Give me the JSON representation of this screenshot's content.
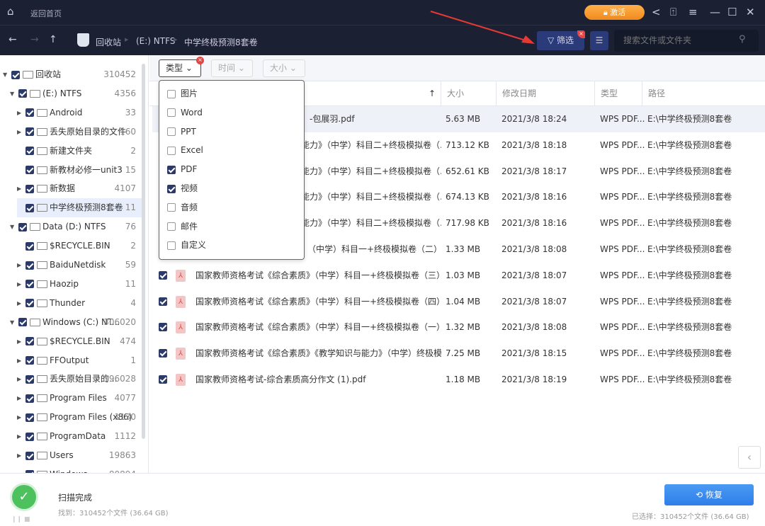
{
  "topbar": {
    "home_label": "返回首页",
    "activate_label": "激活"
  },
  "toolbar": {
    "breadcrumb": [
      "回收站",
      "(E:) NTFS",
      "中学终极预测8套卷"
    ],
    "filter_label": "筛选",
    "search_placeholder": "搜索文件或文件夹"
  },
  "tree": [
    {
      "label": "回收站",
      "count": "310452",
      "level": 0,
      "arrow": "▼",
      "checked": true,
      "icon": "recycle-bin"
    },
    {
      "label": "(E:) NTFS",
      "count": "4356",
      "level": 1,
      "arrow": "▼",
      "checked": true,
      "icon": "drive"
    },
    {
      "label": "Android",
      "count": "33",
      "level": 2,
      "arrow": "▶",
      "checked": true,
      "icon": "folder"
    },
    {
      "label": "丢失原始目录的文件",
      "count": "160",
      "level": 2,
      "arrow": "▶",
      "checked": true,
      "icon": "folder"
    },
    {
      "label": "新建文件夹",
      "count": "2",
      "level": 2,
      "arrow": "",
      "checked": true,
      "icon": "folder"
    },
    {
      "label": "新教材必修一unit3",
      "count": "15",
      "level": 2,
      "arrow": "",
      "checked": true,
      "icon": "folder"
    },
    {
      "label": "新数据",
      "count": "4107",
      "level": 2,
      "arrow": "▶",
      "checked": true,
      "icon": "folder"
    },
    {
      "label": "中学终极预测8套卷",
      "count": "11",
      "level": 2,
      "arrow": "",
      "checked": true,
      "icon": "folder",
      "selected": true
    },
    {
      "label": "Data (D:) NTFS",
      "count": "76",
      "level": 1,
      "arrow": "▼",
      "checked": true,
      "icon": "drive"
    },
    {
      "label": "$RECYCLE.BIN",
      "count": "2",
      "level": 2,
      "arrow": "",
      "checked": true,
      "icon": "recycle-bin"
    },
    {
      "label": "BaiduNetdisk",
      "count": "59",
      "level": 2,
      "arrow": "▶",
      "checked": true,
      "icon": "folder"
    },
    {
      "label": "Haozip",
      "count": "11",
      "level": 2,
      "arrow": "▶",
      "checked": true,
      "icon": "folder"
    },
    {
      "label": "Thunder",
      "count": "4",
      "level": 2,
      "arrow": "▶",
      "checked": true,
      "icon": "folder"
    },
    {
      "label": "Windows (C:) NT...",
      "count": "306020",
      "level": 1,
      "arrow": "▼",
      "checked": true,
      "icon": "drive"
    },
    {
      "label": "$RECYCLE.BIN",
      "count": "474",
      "level": 2,
      "arrow": "▶",
      "checked": true,
      "icon": "recycle-bin"
    },
    {
      "label": "FFOutput",
      "count": "1",
      "level": 2,
      "arrow": "▶",
      "checked": true,
      "icon": "folder"
    },
    {
      "label": "丢失原始目录的...",
      "count": "196028",
      "level": 2,
      "arrow": "▶",
      "checked": true,
      "icon": "folder"
    },
    {
      "label": "Program Files",
      "count": "4077",
      "level": 2,
      "arrow": "▶",
      "checked": true,
      "icon": "folder"
    },
    {
      "label": "Program Files (x86)",
      "count": "1130",
      "level": 2,
      "arrow": "▶",
      "checked": true,
      "icon": "folder"
    },
    {
      "label": "ProgramData",
      "count": "1112",
      "level": 2,
      "arrow": "▶",
      "checked": true,
      "icon": "folder"
    },
    {
      "label": "Users",
      "count": "19863",
      "level": 2,
      "arrow": "▶",
      "checked": true,
      "icon": "folder"
    },
    {
      "label": "Windows",
      "count": "80894",
      "level": 2,
      "arrow": "▶",
      "checked": true,
      "icon": "folder"
    }
  ],
  "filters": [
    {
      "label": "类型",
      "active": true
    },
    {
      "label": "时间",
      "active": false
    },
    {
      "label": "大小",
      "active": false
    }
  ],
  "type_menu": [
    {
      "label": "图片",
      "checked": false
    },
    {
      "label": "Word",
      "checked": false
    },
    {
      "label": "PPT",
      "checked": false
    },
    {
      "label": "Excel",
      "checked": false
    },
    {
      "label": "PDF",
      "checked": true
    },
    {
      "label": "视频",
      "checked": true
    },
    {
      "label": "音频",
      "checked": false
    },
    {
      "label": "邮件",
      "checked": false
    },
    {
      "label": "自定义",
      "checked": false
    }
  ],
  "columns": {
    "sort_icon": "↑",
    "size": "大小",
    "date": "修改日期",
    "type": "类型",
    "path": "路径"
  },
  "files": [
    {
      "name": "-包展羽.pdf",
      "size": "5.63 MB",
      "date": "2021/3/8 18:24",
      "type": "WPS PDF...",
      "path": "E:\\中学终极预测8套卷",
      "partial": true
    },
    {
      "name": "能力》（中学）科目二+终极模拟卷（...",
      "size": "713.12 KB",
      "date": "2021/3/8 18:18",
      "type": "WPS PDF...",
      "path": "E:\\中学终极预测8套卷",
      "partial": true
    },
    {
      "name": "能力》（中学）科目二+终极模拟卷（...",
      "size": "652.61 KB",
      "date": "2021/3/8 18:17",
      "type": "WPS PDF...",
      "path": "E:\\中学终极预测8套卷",
      "partial": true
    },
    {
      "name": "能力》（中学）科目二+终极模拟卷（...",
      "size": "674.13 KB",
      "date": "2021/3/8 18:16",
      "type": "WPS PDF...",
      "path": "E:\\中学终极预测8套卷",
      "partial": true
    },
    {
      "name": "能力》（中学）科目二+终极模拟卷（...",
      "size": "717.98 KB",
      "date": "2021/3/8 18:16",
      "type": "WPS PDF...",
      "path": "E:\\中学终极预测8套卷",
      "partial": true
    },
    {
      "name": "（中学）科目一+终极模拟卷（二）.pdf",
      "size": "1.33 MB",
      "date": "2021/3/8 18:08",
      "type": "WPS PDF...",
      "path": "E:\\中学终极预测8套卷",
      "partial": true
    },
    {
      "name": "国家教师资格考试《综合素质》（中学）科目一+终极模拟卷（三）.pdf",
      "size": "1.03 MB",
      "date": "2021/3/8 18:07",
      "type": "WPS PDF...",
      "path": "E:\\中学终极预测8套卷"
    },
    {
      "name": "国家教师资格考试《综合素质》（中学）科目一+终极模拟卷（四）.pdf",
      "size": "1.04 MB",
      "date": "2021/3/8 18:07",
      "type": "WPS PDF...",
      "path": "E:\\中学终极预测8套卷"
    },
    {
      "name": "国家教师资格考试《综合素质》（中学）科目一+终极模拟卷（一）.pdf",
      "size": "1.32 MB",
      "date": "2021/3/8 18:08",
      "type": "WPS PDF...",
      "path": "E:\\中学终极预测8套卷"
    },
    {
      "name": "国家教师资格考试《综合素质》《教学知识与能力》（中学）终极模...",
      "size": "7.25 MB",
      "date": "2021/3/8 18:15",
      "type": "WPS PDF...",
      "path": "E:\\中学终极预测8套卷"
    },
    {
      "name": "国家教师资格考试-综合素质高分作文 (1).pdf",
      "size": "1.18 MB",
      "date": "2021/3/8 18:19",
      "type": "WPS PDF...",
      "path": "E:\\中学终极预测8套卷"
    }
  ],
  "status": {
    "title": "扫描完成",
    "found": "找到：310452个文件 (36.64 GB)",
    "selected": "已选择：310452个文件 (36.64 GB)",
    "restore_label": "恢复"
  },
  "colors": {
    "dark_bg": "#1c2033",
    "accent": "#2f7ee9",
    "activate": "#f08a1e",
    "checkbox": "#2b3a68",
    "arrow_annotation": "#e53935"
  }
}
